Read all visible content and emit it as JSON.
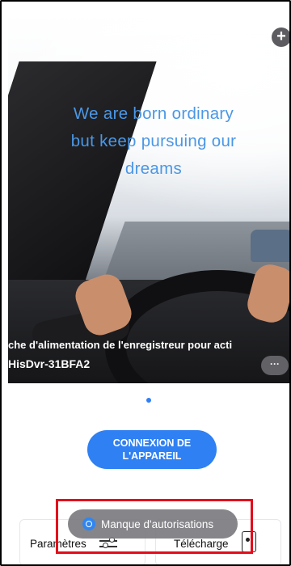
{
  "hero": {
    "tagline": [
      "We are born ordinary",
      "but keep pursuing our",
      "dreams"
    ],
    "caption": "che d'alimentation de l'enregistreur pour acti",
    "device_name": "HisDvr-31BFA2",
    "more_label": "···",
    "add_label": "+"
  },
  "carousel": {
    "pages": 1,
    "active": 1
  },
  "connect_button": {
    "label": "CONNEXION DE L'APPAREIL"
  },
  "cards": {
    "settings_label": "Paramètres",
    "download_label": "Télécharge"
  },
  "toast": {
    "text": "Manque d'autorisations"
  },
  "colors": {
    "accent": "#2f80f3",
    "highlight": "#e30d1b",
    "tagline": "#4a97e6"
  }
}
